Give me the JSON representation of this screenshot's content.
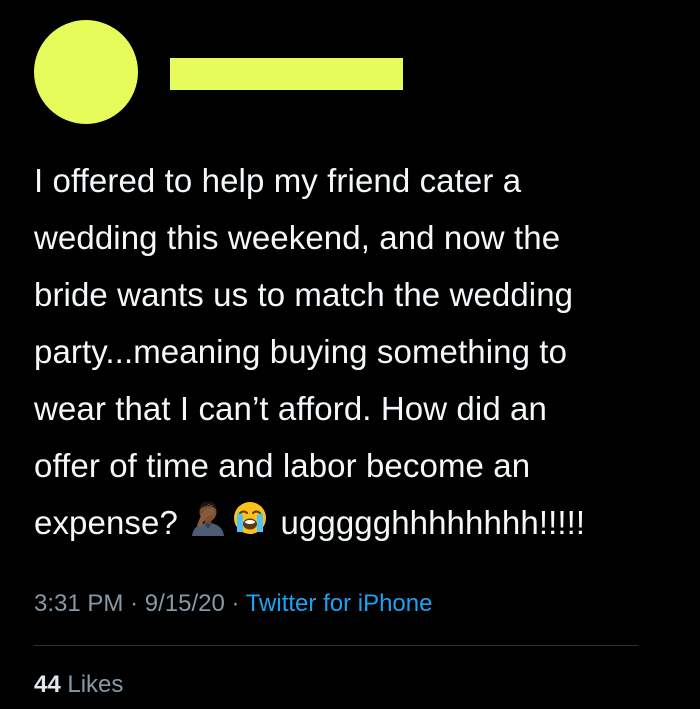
{
  "colors": {
    "background": "#000000",
    "redaction": "#e6fc5b",
    "text": "#f5f8fa",
    "muted": "#8899a6",
    "link": "#1da1f2"
  },
  "tweet": {
    "lines": [
      "I offered to help my friend cater a",
      "wedding this weekend, and now the",
      "bride wants us to match the wedding",
      "party...meaning buying something to",
      "wear that I can’t afford. How did an",
      "offer of time and labor become an"
    ],
    "last_line_prefix": "expense?",
    "emoji_1": "facepalm-emoji",
    "emoji_2": "loudly-crying-face-emoji",
    "last_line_suffix": "uggggghhhhhhhh!!!!!"
  },
  "meta": {
    "time": "3:31 PM",
    "separator": "·",
    "date": "9/15/20",
    "source": "Twitter for iPhone"
  },
  "likes": {
    "count": "44",
    "label": "Likes"
  }
}
